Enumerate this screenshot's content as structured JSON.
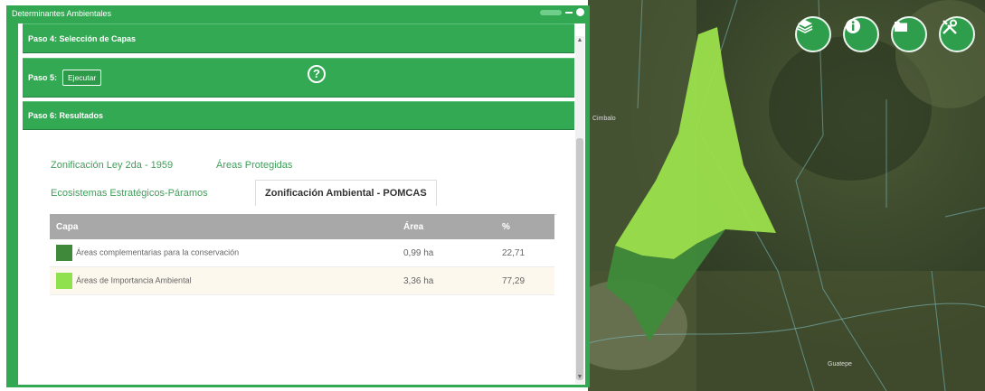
{
  "panel": {
    "title": "Determinantes Ambientales",
    "step4": "Paso 4: Selección de Capas",
    "step5": "Paso 5:",
    "execute_label": "Ejecutar",
    "help_symbol": "?",
    "step6": "Paso 6: Resultados"
  },
  "tabs": [
    {
      "label": "Zonificación Ley 2da - 1959",
      "active": false
    },
    {
      "label": "Áreas Protegidas",
      "active": false
    },
    {
      "label": "Ecosistemas Estratégicos-Páramos",
      "active": false
    },
    {
      "label": "Zonificación Ambiental - POMCAS",
      "active": true
    }
  ],
  "table": {
    "headers": [
      "Capa",
      "Área",
      "%"
    ],
    "rows": [
      {
        "color": "#3f8a3a",
        "capa": "Áreas complementarias para la conservación",
        "area": "0,99 ha",
        "pct": "22,71"
      },
      {
        "color": "#8fe24e",
        "capa": "Áreas de Importancia Ambiental",
        "area": "3,36 ha",
        "pct": "77,29"
      }
    ]
  },
  "map": {
    "buttons": [
      "layers-icon",
      "info-icon",
      "folder-icon",
      "tools-icon"
    ],
    "label_left": "Cimbalo",
    "label_bottom": "Guatepe",
    "polygon_colors": {
      "light": "#9be04c",
      "dark": "#3f8a3a"
    }
  }
}
